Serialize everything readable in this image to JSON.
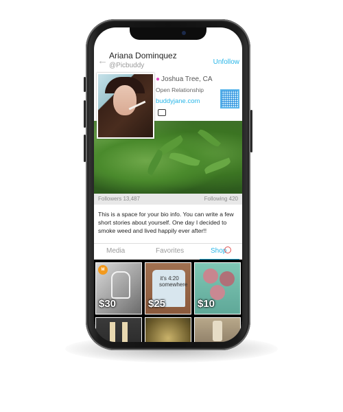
{
  "profile": {
    "name": "Ariana Dominquez",
    "handle": "@Picbuddy",
    "follow_action": "Unfollow",
    "location": "Joshua Tree, CA",
    "relationship": "Open Relationship",
    "website": "buddyjane.com"
  },
  "stats": {
    "followers": "Followers 13,487",
    "following": "Following 420"
  },
  "bio": "This is a space for your bio info. You can write a few short stories about yourself. One day I decided to smoke weed and lived happily ever after!!",
  "tabs": [
    {
      "label": "Media",
      "active": false
    },
    {
      "label": "Favorites",
      "active": false
    },
    {
      "label": "Shop",
      "active": true
    }
  ],
  "shop_items": [
    {
      "price": "$30",
      "badge": "M"
    },
    {
      "price": "$25",
      "shirt_text": "it's 4:20 somewhere"
    },
    {
      "price": "$10"
    }
  ],
  "colors": {
    "accent": "#29b6e8",
    "pin": "#e04fc0",
    "badge": "#f29a1e"
  },
  "icons": [
    "back-arrow-icon",
    "location-pin-icon",
    "message-icon",
    "qr-code-icon"
  ]
}
